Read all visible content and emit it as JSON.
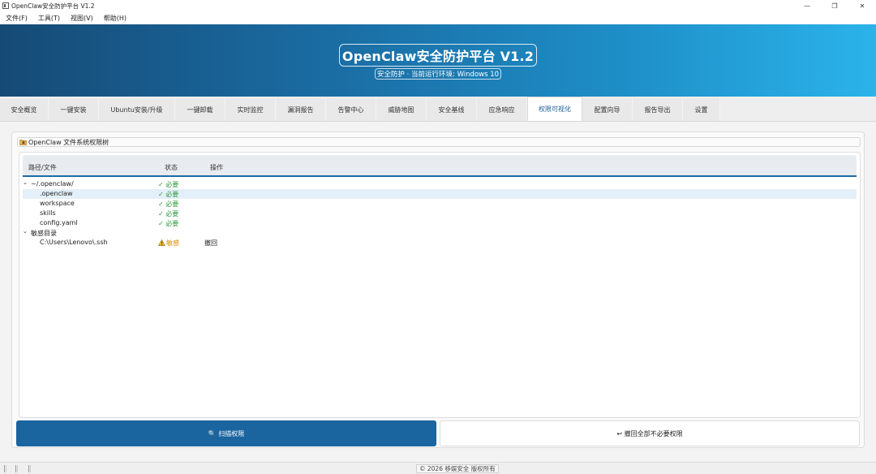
{
  "window": {
    "title": "OpenClaw安全防护平台 V1.2",
    "controls": [
      "—",
      "❐",
      "✕"
    ]
  },
  "menu": [
    "文件(F)",
    "工具(T)",
    "视图(V)",
    "帮助(H)"
  ],
  "banner": {
    "title": "OpenClaw安全防护平台 V1.2",
    "subtitle": "安全防护 · 当前运行环境: Windows 10"
  },
  "tabs": [
    "安全概览",
    "一键安装",
    "Ubuntu安装/升级",
    "一键卸载",
    "实时监控",
    "漏洞报告",
    "告警中心",
    "威胁地图",
    "安全基线",
    "应急响应",
    "权限可视化",
    "配置向导",
    "报告导出",
    "设置"
  ],
  "active_tab": "权限可视化",
  "section": {
    "title": "OpenClaw 文件系统权限树"
  },
  "tree": {
    "headers": {
      "path": "路径/文件",
      "status": "状态",
      "action": "操作"
    },
    "rows": [
      {
        "path": "~/.openclaw/",
        "status": "✓ 必要",
        "action": "",
        "expander": "⌄"
      },
      {
        "path": ".openclaw",
        "status": "✓ 必要",
        "action": ""
      },
      {
        "path": "workspace",
        "status": "✓ 必要",
        "action": ""
      },
      {
        "path": "skills",
        "status": "✓ 必要",
        "action": ""
      },
      {
        "path": "config.yaml",
        "status": "✓ 必要",
        "action": ""
      },
      {
        "path": "敏感目录",
        "status": "",
        "action": "",
        "expander": "⌄"
      },
      {
        "path": "C:\\Users\\Lenovo\\.ssh",
        "status": "敏感",
        "action": "撤回"
      }
    ]
  },
  "buttons": {
    "scan": "🔍 扫描权限",
    "revoke_all": "↩ 撤回全部不必要权限"
  },
  "status": {
    "copyright": "© 2026 移娱安全 版权所有"
  },
  "colors": {
    "accent": "#1a64a0",
    "ok": "#2e9a3e",
    "warn": "#d98a00"
  }
}
